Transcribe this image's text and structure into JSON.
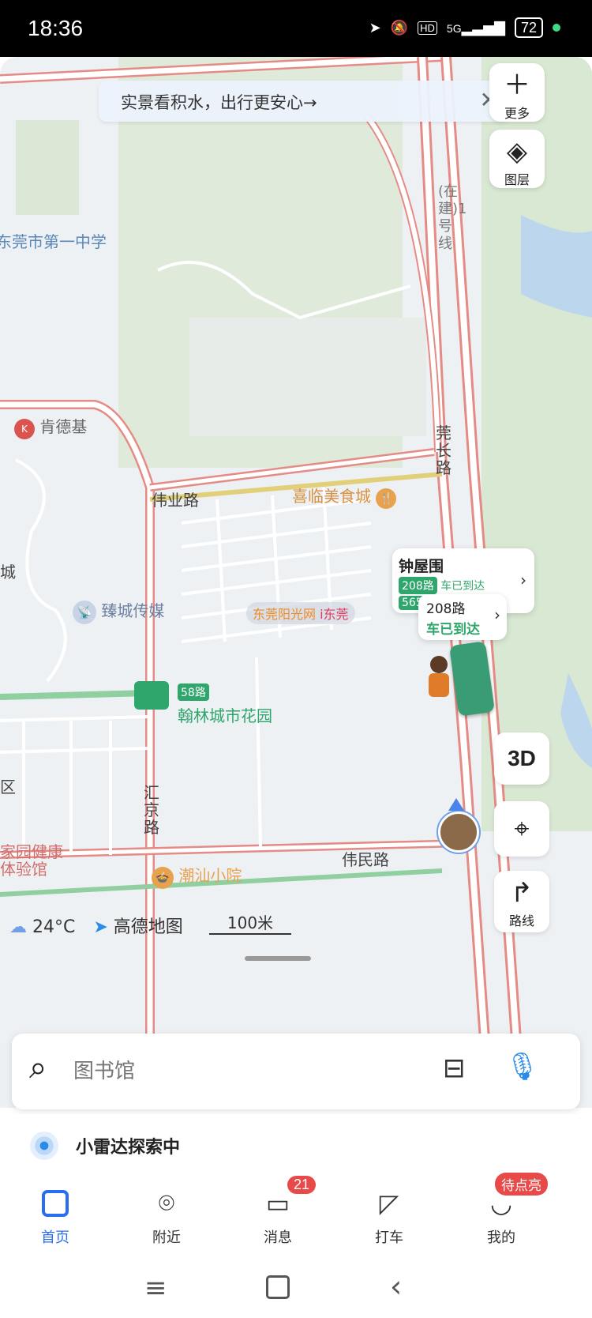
{
  "status_bar": {
    "time": "18:36",
    "network": "5G",
    "hd": "HD",
    "battery": "72"
  },
  "banner": {
    "text": "实景看积水，出行更安心→",
    "close": "✕"
  },
  "side_buttons": {
    "more": "更多",
    "layers": "图层",
    "three_d": "3D",
    "route": "路线"
  },
  "map_labels": {
    "school": "东莞市第一中学",
    "metro": "(在建)1号线",
    "kfc": "肯德基",
    "weiye_road": "伟业路",
    "food_city": "喜临美食城",
    "guanchang_road": "莞长路",
    "zhencheng": "臻城传媒",
    "city_left": "城",
    "bus58": "58路",
    "hanlin": "翰林城市花园",
    "huijing_road": "汇京路",
    "health": "家园健康体验馆",
    "weimin_road": "伟民路",
    "chaoshan": "潮汕小院",
    "district": "区",
    "watermark1": "东莞阳光网",
    "watermark2": "i东莞"
  },
  "bus_stop": {
    "name": "钟屋围",
    "route1": "208路",
    "route1_status": "车已到达",
    "route2": "565"
  },
  "bus_bubble": {
    "route": "208路",
    "status": "车已到达"
  },
  "map_info": {
    "weather": "24°C",
    "brand": "高德地图",
    "scale": "100米"
  },
  "search": {
    "placeholder": "图书馆"
  },
  "radar": {
    "text": "小雷达探索中"
  },
  "tabs": [
    {
      "label": "首页",
      "active": true
    },
    {
      "label": "附近"
    },
    {
      "label": "消息",
      "badge": "21"
    },
    {
      "label": "打车"
    },
    {
      "label": "我的",
      "badge": "待点亮"
    }
  ],
  "colors": {
    "accent": "#2a6ef0",
    "bus_green": "#2fa66b",
    "road_red": "#e58b86",
    "badge_red": "#e84a4a"
  }
}
